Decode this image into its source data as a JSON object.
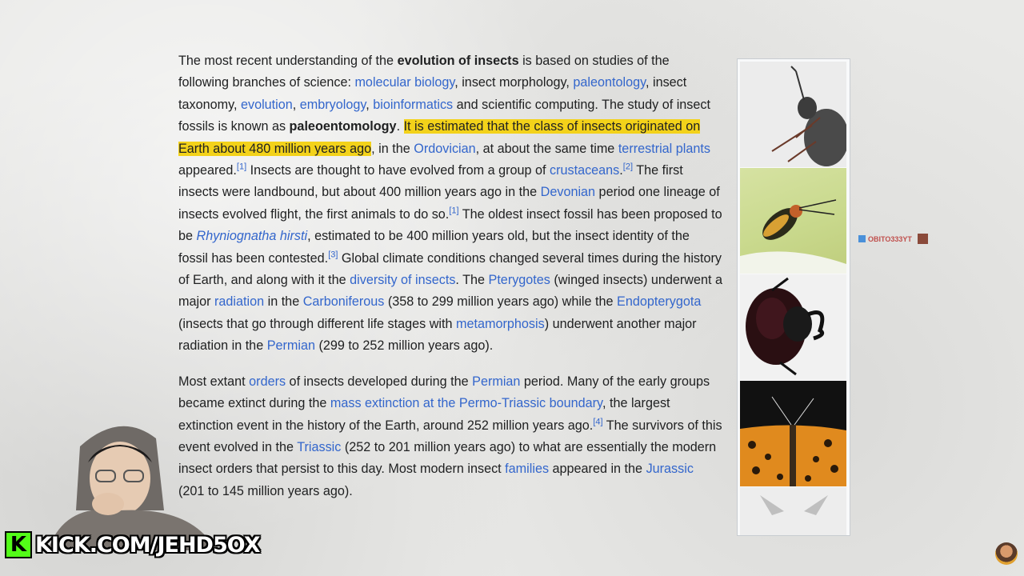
{
  "article": {
    "p1": {
      "s1": "The most recent understanding of the ",
      "b1": "evolution of insects",
      "s2": " is based on studies of the following branches of science: ",
      "l_molbio": "molecular biology",
      "s3": ", insect morphology, ",
      "l_paleo": "paleontology",
      "s4": ", insect taxonomy, ",
      "l_evolution": "evolution",
      "s5": ", ",
      "l_embryology": "embryology",
      "s6": ", ",
      "l_bioinf": "bioinformatics",
      "s7": " and scientific computing. The study of insect fossils is known as ",
      "b2": "paleoentomology",
      "s8": ". ",
      "highlight": "It is estimated that the class of insects originated on Earth about 480 million years ago",
      "s9": ", in the ",
      "l_ordovician": "Ordovician",
      "s10": ", at about the same time ",
      "l_terr": "terrestrial plants",
      "s11": " appeared.",
      "ref1": "[1]",
      "s12": " Insects are thought to have evolved from a group of ",
      "l_crust": "crustaceans",
      "s13": ".",
      "ref2": "[2]",
      "s14": " The first insects were landbound, but about 400 million years ago in the ",
      "l_devonian": "Devonian",
      "s15": " period one lineage of insects evolved flight, the first animals to do so.",
      "ref3": "[1]",
      "s16": " The oldest insect fossil has been proposed to be ",
      "l_rhynio": "Rhyniognatha hirsti",
      "s17": ", estimated to be 400 million years old, but the insect identity of the fossil has been contested.",
      "ref4": "[3]",
      "s18": " Global climate conditions changed several times during the history of Earth, and along with it the ",
      "l_diversity": "diversity of insects",
      "s19": ". The ",
      "l_ptery": "Pterygotes",
      "s20": " (winged insects) underwent a major ",
      "l_radiation": "radiation",
      "s21": " in the ",
      "l_carbon": "Carboniferous",
      "s22": " (358 to 299 million years ago) while the ",
      "l_endo": "Endopterygota",
      "s23": " (insects that go through different life stages with ",
      "l_meta": "metamorphosis",
      "s24": ") underwent another major radiation in the ",
      "l_permian": "Permian",
      "s25": " (299 to 252 million years ago)."
    },
    "p2": {
      "s1": "Most extant ",
      "l_orders": "orders",
      "s2": " of insects developed during the ",
      "l_permian": "Permian",
      "s3": " period. Many of the early groups became extinct during the ",
      "l_mass": "mass extinction at the Permo-Triassic boundary",
      "s4": ", the largest extinction event in the history of the Earth, around 252 million years ago.",
      "ref": "[4]",
      "s5": " The survivors of this event evolved in the ",
      "l_triassic": "Triassic",
      "s6": " (252 to 201 million years ago) to what are essentially the modern insect orders that persist to this day. Most modern insect ",
      "l_families": "families",
      "s7": " appeared in the ",
      "l_jurassic": "Jurassic",
      "s8": " (201 to 145 million years ago)."
    }
  },
  "overlay": {
    "kick_logo": "K",
    "kick_text": "KICK.COM/JEHD5OX",
    "watermark": "OBITO333YT"
  },
  "colors": {
    "link": "#3366cc",
    "highlight": "#f3d21a",
    "kick_green": "#53fc18"
  }
}
